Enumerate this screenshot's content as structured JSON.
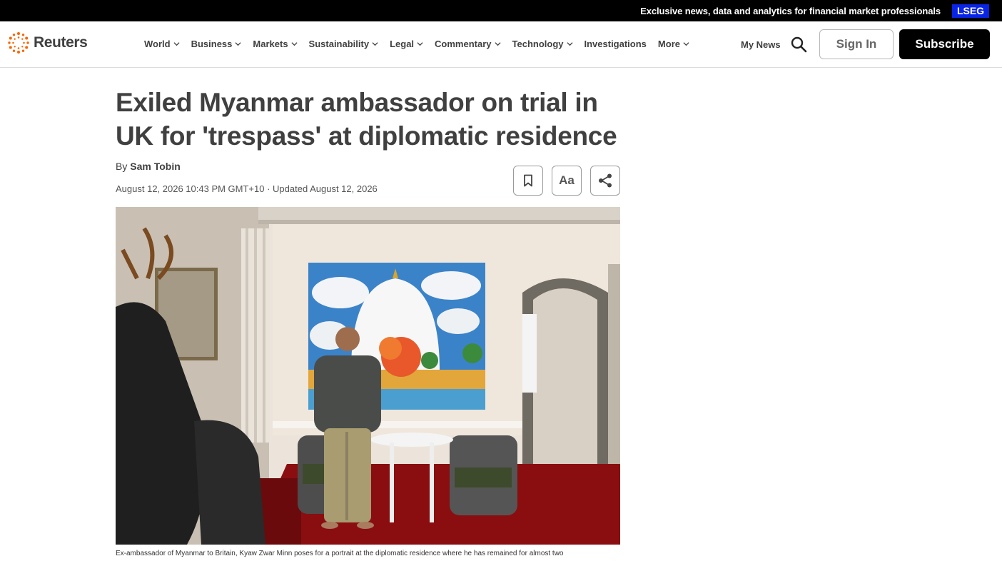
{
  "topbar": {
    "promo": "Exclusive news, data and analytics for financial market professionals",
    "partner": "LSEG"
  },
  "header": {
    "brand": "Reuters",
    "nav": [
      {
        "label": "World",
        "dropdown": true
      },
      {
        "label": "Business",
        "dropdown": true
      },
      {
        "label": "Markets",
        "dropdown": true
      },
      {
        "label": "Sustainability",
        "dropdown": true
      },
      {
        "label": "Legal",
        "dropdown": true
      },
      {
        "label": "Commentary",
        "dropdown": true
      },
      {
        "label": "Technology",
        "dropdown": true
      },
      {
        "label": "Investigations",
        "dropdown": false
      },
      {
        "label": "More",
        "dropdown": true
      }
    ],
    "my_news": "My News",
    "sign_in": "Sign In",
    "subscribe": "Subscribe"
  },
  "article": {
    "headline": "Exiled Myanmar ambassador on trial in UK for 'trespass' at diplomatic residence",
    "by": "By",
    "author": "Sam Tobin",
    "dateline": "August 12, 2026 10:43 PM GMT+10 · Updated August 12, 2026",
    "tools": {
      "text_size": "Aa"
    },
    "caption": "Ex-ambassador of Myanmar to Britain, Kyaw Zwar Minn poses for a portrait at the diplomatic residence where he has remained for almost two"
  },
  "icons": {
    "logo": "reuters-logo-icon",
    "search": "search-icon",
    "bookmark": "bookmark-icon",
    "share": "share-icon",
    "chevron": "chevron-down-icon"
  },
  "colors": {
    "brand_orange": "#fa6400",
    "lseg_blue": "#0a24e6",
    "text": "#404040"
  }
}
